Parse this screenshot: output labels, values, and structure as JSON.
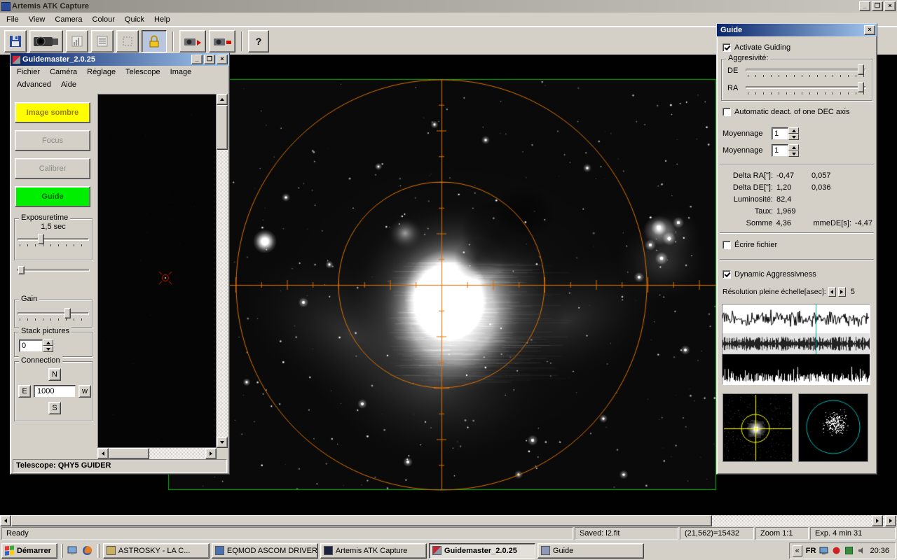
{
  "artemis": {
    "title": "Artemis ATK Capture",
    "menus": [
      "File",
      "View",
      "Camera",
      "Colour",
      "Quick",
      "Help"
    ],
    "status": {
      "ready": "Ready",
      "saved": "Saved: l2.fit",
      "pixel": "(21,562)=15432",
      "zoom": "Zoom 1:1",
      "exposure": "Exp. 4 min 31"
    }
  },
  "guidemaster": {
    "title": "Guidemaster_2.0.25",
    "menus_row1": [
      "Fichier",
      "Caméra",
      "Réglage",
      "Telescope",
      "Image"
    ],
    "menus_row2": [
      "Advanced",
      "Aide"
    ],
    "buttons": {
      "dark": "Image sombre",
      "focus": "Focus",
      "calibrate": "Calibrer",
      "guide": "Guide"
    },
    "groups": {
      "exposure": "Exposuretime",
      "gain": "Gain",
      "stack": "Stack pictures",
      "connection": "Connection"
    },
    "exposure_value": "1,5 sec",
    "stack_value": "0",
    "pulse_value": "1000",
    "dirs": {
      "n": "N",
      "e": "E",
      "w": "w",
      "s": "S"
    },
    "status": "Telescope: QHY5 GUIDER"
  },
  "guide": {
    "title": "Guide",
    "activate_label": "Activate Guiding",
    "aggressivity_label": "Aggresivité:",
    "de_label": "DE",
    "ra_label": "RA",
    "auto_deact_label": "Automatic deact. of one DEC axis",
    "avg1_label": "Moyennage",
    "avg2_label": "Moyennage",
    "avg1_value": "1",
    "avg2_value": "1",
    "stats": {
      "delta_ra_label": "Delta RA[\"]:",
      "delta_ra_v1": "-0,47",
      "delta_ra_v2": "0,057",
      "delta_de_label": "Delta DE[\"]:",
      "delta_de_v1": "1,20",
      "delta_de_v2": "0,036",
      "lum_label": "Luminosité:",
      "lum_value": "82,4",
      "taux_label": "Taux:",
      "taux_value": "1,969",
      "somme_label": "Somme",
      "somme_value": "4,36",
      "somme_de_label": "mmeDE[s]:",
      "somme_de_value": "-4,47"
    },
    "write_file_label": "Écrire fichier",
    "dynamic_label": "Dynamic Aggressivness",
    "resolution_label": "Résolution pleine échelle[asec]:",
    "resolution_value": "5"
  },
  "taskbar": {
    "start_label": "Démarrer",
    "tasks": [
      "ASTROSKY    -    LA C...",
      "EQMOD ASCOM DRIVER",
      "Artemis ATK Capture",
      "Guidemaster_2.0.25",
      "Guide"
    ],
    "tray_lang": "FR",
    "tray_time": "20:36"
  },
  "glyphs": {
    "minimize": "_",
    "maximize": "❐",
    "close": "×",
    "help": "?",
    "chevron": "«"
  },
  "colors": {
    "frame_green": "#00b400",
    "crosshair_orange": "#dd7200",
    "guide_button_green": "#00ee00",
    "dark_button_yellow": "#ffff00",
    "target_red": "#dd2200",
    "cross_yellow": "#ffff00",
    "scatter_cyan": "#00b8b8"
  }
}
